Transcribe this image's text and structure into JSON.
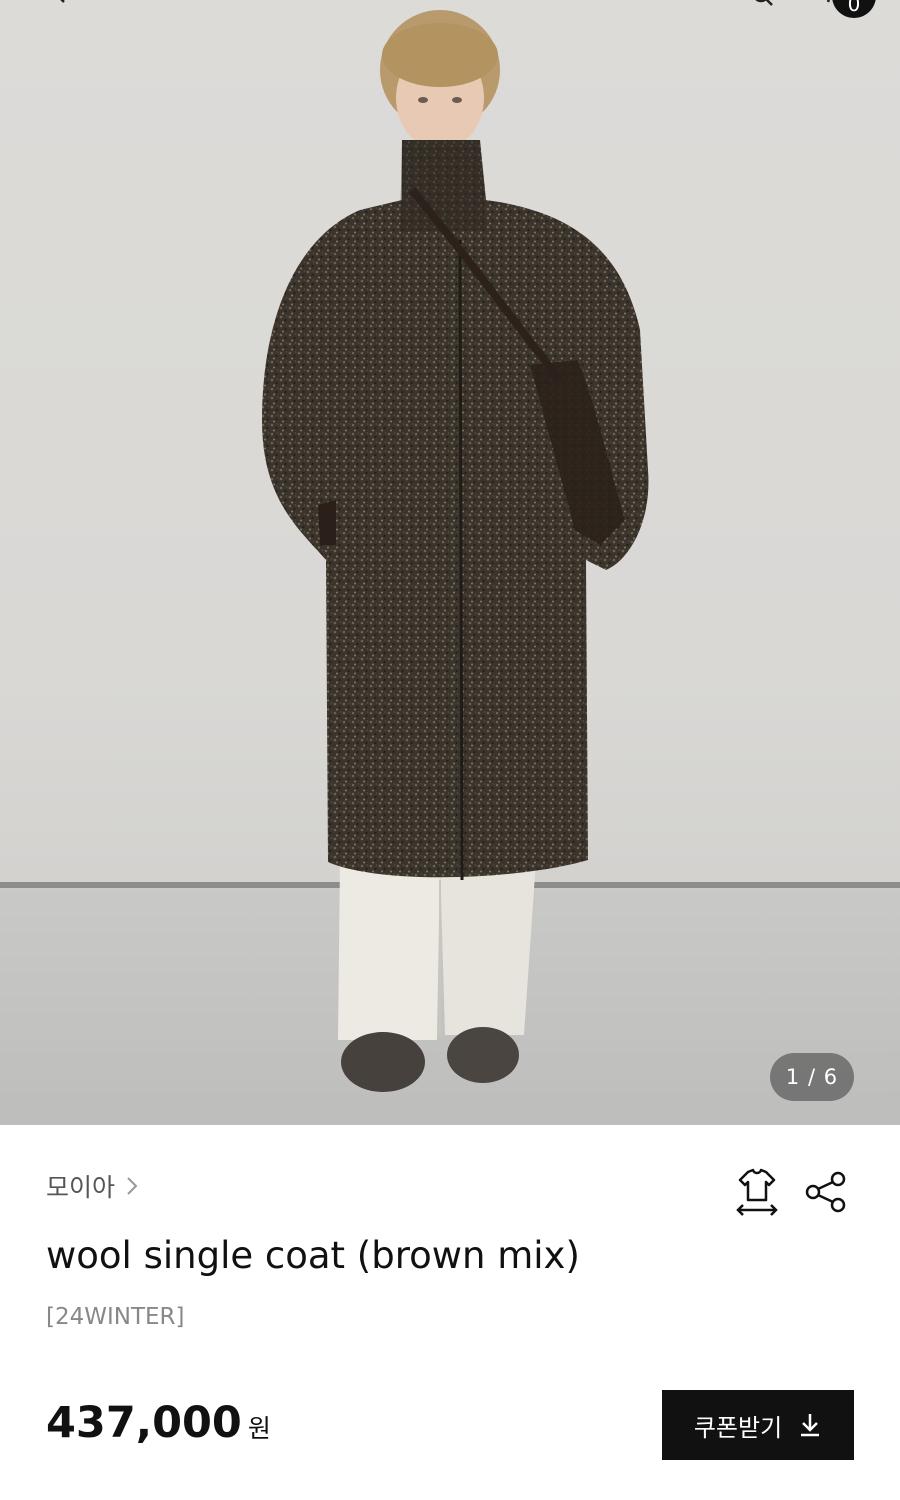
{
  "header": {
    "cart_count": "0",
    "icons": [
      "back-icon",
      "menu-icon",
      "search-icon",
      "cart-icon"
    ]
  },
  "gallery": {
    "counter": "1 / 6"
  },
  "product": {
    "brand": "모이아",
    "title": "wool single coat (brown mix)",
    "season": "[24WINTER]",
    "price": "437,000",
    "currency": "원"
  },
  "actions": {
    "coupon_label": "쿠폰받기",
    "icons": [
      "size-guide-icon",
      "share-icon",
      "download-icon"
    ]
  },
  "colors": {
    "wall": "#dcdbd8",
    "floor": "#c4c4c2",
    "coat": "#3d352d",
    "button": "#111111",
    "counter_pill": "#5a5a5a"
  }
}
